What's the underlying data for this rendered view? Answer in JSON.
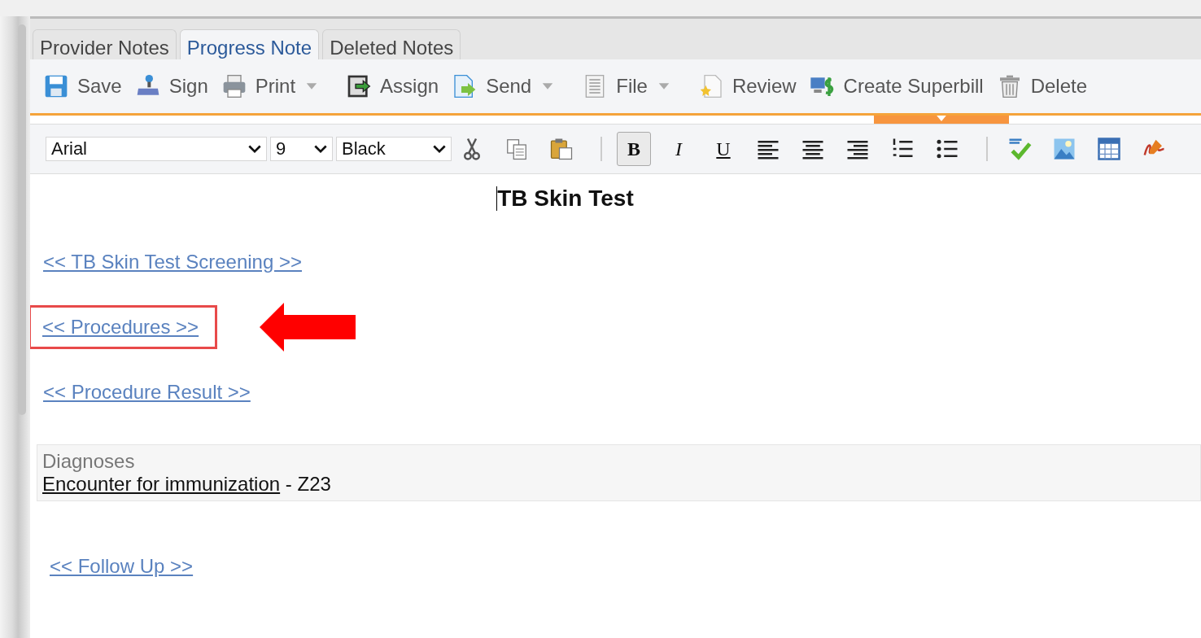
{
  "tabs": [
    {
      "label": "Provider Notes",
      "selected": false
    },
    {
      "label": "Progress Note",
      "selected": true
    },
    {
      "label": "Deleted Notes",
      "selected": false
    }
  ],
  "actions": [
    {
      "kind": "save",
      "label": "Save",
      "dropdown": false
    },
    {
      "kind": "sign",
      "label": "Sign",
      "dropdown": false
    },
    {
      "kind": "print",
      "label": "Print",
      "dropdown": true
    },
    {
      "kind": "assign",
      "label": "Assign",
      "dropdown": false
    },
    {
      "kind": "send",
      "label": "Send",
      "dropdown": true
    },
    {
      "kind": "file",
      "label": "File",
      "dropdown": true
    },
    {
      "kind": "review",
      "label": "Review",
      "dropdown": false
    },
    {
      "kind": "superbill",
      "label": "Create Superbill",
      "dropdown": false
    },
    {
      "kind": "delete",
      "label": "Delete",
      "dropdown": false
    }
  ],
  "format": {
    "font": "Arial",
    "size": "9",
    "color_name": "Black"
  },
  "format_buttons": [
    {
      "kind": "cut"
    },
    {
      "kind": "copy"
    },
    {
      "kind": "paste"
    },
    {
      "kind": "sep"
    },
    {
      "kind": "bold",
      "label": "B",
      "selected": true
    },
    {
      "kind": "italic",
      "label": "I",
      "selected": false
    },
    {
      "kind": "underline",
      "label": "U",
      "selected": false
    },
    {
      "kind": "align-left"
    },
    {
      "kind": "align-center"
    },
    {
      "kind": "align-right"
    },
    {
      "kind": "ordered-list"
    },
    {
      "kind": "bullet-list"
    },
    {
      "kind": "sep"
    },
    {
      "kind": "spellcheck"
    },
    {
      "kind": "image"
    },
    {
      "kind": "table"
    },
    {
      "kind": "signature"
    }
  ],
  "document": {
    "title": "TB Skin Test",
    "sections": [
      {
        "kind": "link",
        "label": "<< TB Skin Test Screening >>",
        "highlighted": false
      },
      {
        "kind": "link",
        "label": "<< Procedures >>",
        "highlighted": true
      },
      {
        "kind": "link",
        "label": "<< Procedure Result >>",
        "highlighted": false
      },
      {
        "kind": "diagnoses",
        "heading": "Diagnoses",
        "name": "Encounter for immunization",
        "code": " - Z23"
      },
      {
        "kind": "link",
        "label": "<< Follow Up >>",
        "highlighted": false,
        "indent": true
      }
    ]
  }
}
